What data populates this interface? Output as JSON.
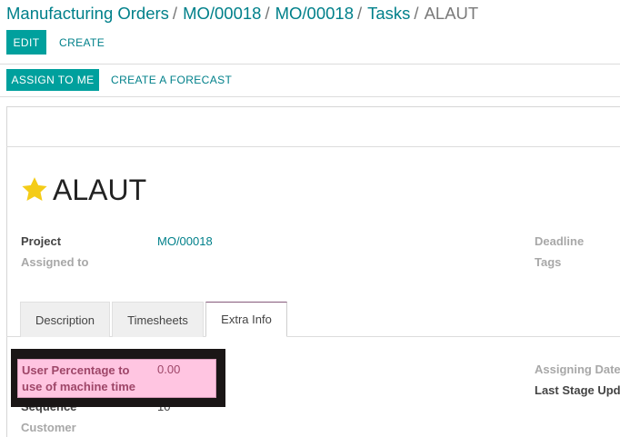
{
  "breadcrumb": {
    "items": [
      "Manufacturing Orders",
      "MO/00018",
      "MO/00018",
      "Tasks"
    ],
    "current": "ALAUT",
    "separator": "/"
  },
  "toolbar": {
    "edit_label": "EDIT",
    "create_label": "CREATE"
  },
  "statusbar": {
    "assign_label": "ASSIGN TO ME",
    "forecast_label": "CREATE A FORECAST"
  },
  "record": {
    "title": "ALAUT",
    "starred": true,
    "fields_left": [
      {
        "label": "Project",
        "value": "MO/00018"
      },
      {
        "label": "Assigned to",
        "value": ""
      }
    ],
    "fields_right": [
      {
        "label": "Deadline",
        "value": ""
      },
      {
        "label": "Tags",
        "value": ""
      }
    ]
  },
  "tabs": [
    {
      "label": "Description",
      "active": false
    },
    {
      "label": "Timesheets",
      "active": false
    },
    {
      "label": "Extra Info",
      "active": true
    }
  ],
  "extra_info": {
    "user_percentage_label": "User Percentage to use of machine time",
    "user_percentage_value": "0.00",
    "sequence_label": "Sequence",
    "sequence_value": "10",
    "customer_label": "Customer",
    "assigning_date_label": "Assigning Date",
    "last_stage_update_label": "Last Stage Upda"
  },
  "colors": {
    "accent": "#00a09d",
    "link": "#00808a",
    "highlight": "#ffc5e1",
    "tab_active_border": "#875a7b"
  }
}
